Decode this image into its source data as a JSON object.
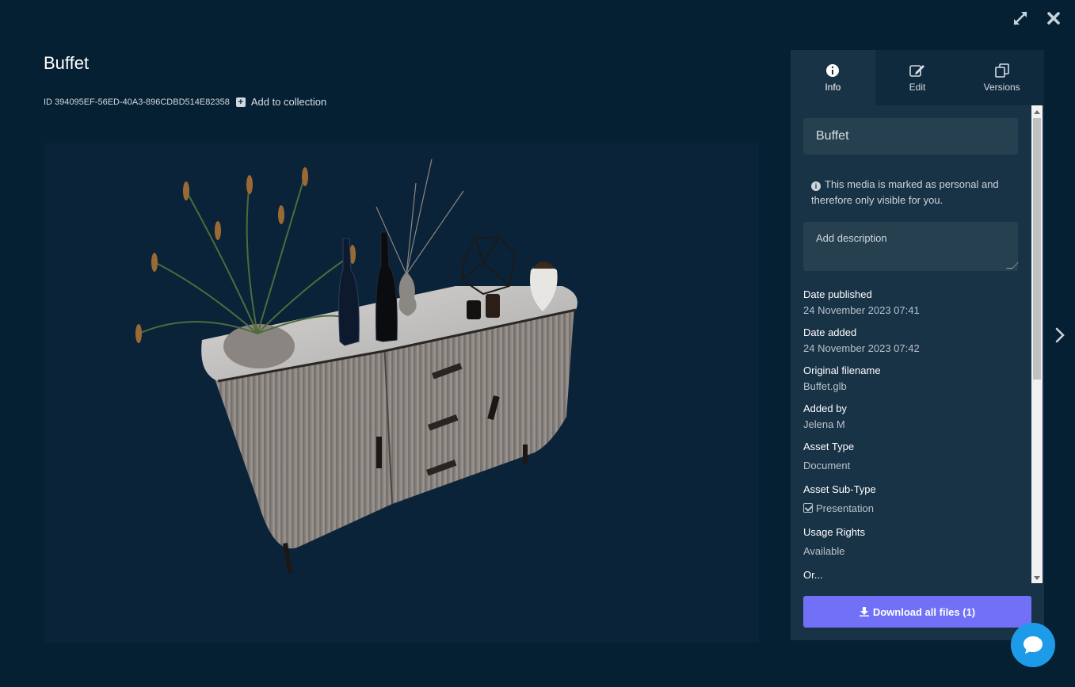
{
  "asset": {
    "title": "Buffet",
    "id_text": "ID 394095EF-56ED-40A3-896CDBD514E82358",
    "add_to_collection": "Add to collection"
  },
  "window_icons": [
    "expand-icon",
    "close-icon"
  ],
  "tabs": [
    {
      "label": "Info",
      "icon": "info-icon",
      "active": true
    },
    {
      "label": "Edit",
      "icon": "edit-icon",
      "active": false
    },
    {
      "label": "Versions",
      "icon": "versions-icon",
      "active": false
    }
  ],
  "info": {
    "name_value": "Buffet",
    "notice": "This media is marked as personal and therefore only visible for you.",
    "description_placeholder": "Add description",
    "fields": {
      "date_published_label": "Date published",
      "date_published_value": "24 November 2023 07:41",
      "date_added_label": "Date added",
      "date_added_value": "24 November 2023 07:42",
      "original_filename_label": "Original filename",
      "original_filename_value": "Buffet.glb",
      "added_by_label": "Added by",
      "added_by_value": "Jelena M",
      "asset_type_label": "Asset Type",
      "asset_type_value": "Document",
      "asset_subtype_label": "Asset Sub-Type",
      "asset_subtype_value": "Presentation",
      "usage_rights_label": "Usage Rights",
      "usage_rights_value": "Available",
      "cut_off_label": "Or..."
    }
  },
  "download_label": "Download all files (1)",
  "colors": {
    "background": "#062033",
    "panel": "#183246",
    "accent_button": "#7170f7",
    "chat_button": "#1e9be8"
  }
}
